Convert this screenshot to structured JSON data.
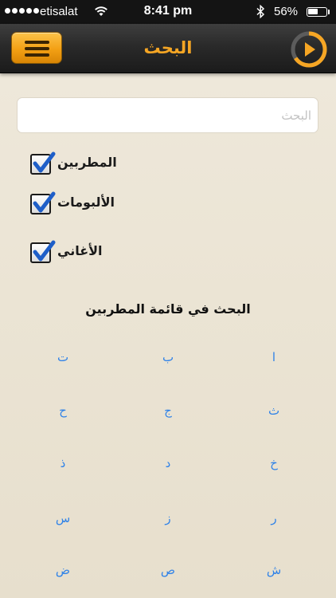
{
  "status_bar": {
    "carrier": "etisalat",
    "time": "8:41 pm",
    "battery_percent": "56%",
    "battery_level": 0.56,
    "signal_bars": 5
  },
  "nav_bar": {
    "title": "البحث",
    "menu_icon": "hamburger-icon",
    "play_icon": "play-icon",
    "accent_color": "#f6a624"
  },
  "search": {
    "placeholder": "البحث",
    "value": ""
  },
  "filters": [
    {
      "label": "المطربين",
      "checked": true
    },
    {
      "label": "الألبومات",
      "checked": true
    },
    {
      "label": "الأغاني",
      "checked": true
    }
  ],
  "letter_section": {
    "title": "البحث في قائمة المطربين",
    "letters": [
      [
        "ا",
        "ب",
        "ت"
      ],
      [
        "ث",
        "ج",
        "ح"
      ],
      [
        "خ",
        "د",
        "ذ"
      ],
      [
        "ر",
        "ز",
        "س"
      ],
      [
        "ش",
        "ص",
        "ض"
      ]
    ],
    "link_color": "#2f82e8"
  }
}
